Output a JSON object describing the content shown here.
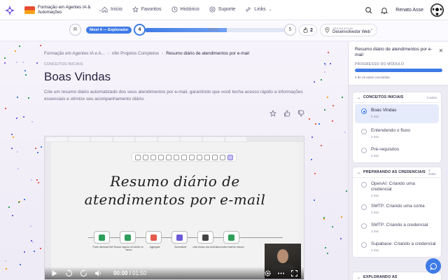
{
  "topnav": {
    "course_title": "Formação em Agentes IA & Automações",
    "links": [
      {
        "label": "Início",
        "icon": "home-icon"
      },
      {
        "label": "Favoritos",
        "icon": "star-icon"
      },
      {
        "label": "Histórico",
        "icon": "clock-icon"
      },
      {
        "label": "Suporte",
        "icon": "help-icon"
      },
      {
        "label": "Links",
        "icon": "link-icon"
      }
    ],
    "user_name": "Renato Asse"
  },
  "progress": {
    "rank": "R",
    "level_label": "Nível 4 — Explorador",
    "level_current": "4",
    "level_next": "5",
    "xp_text": "88/150",
    "xp_fraction": 0.587,
    "streak": "2",
    "track_small": "TRILHA ATUAL",
    "track_name": "Desenvolvedor Web"
  },
  "main": {
    "crumbs": [
      "Formação em Agentes IA e A...",
      "n8n Projetos Completos",
      "Resumo diário de atendimentos por e-mail"
    ],
    "section_tag": "CONCEITOS INICIAIS",
    "title": "Boas Vindas",
    "description": "Crie um resumo diário automatizado dos seus atendimentos por e-mail, garantindo que você tenha acesso rápido a informações essenciais e otimize seu acompanhamento diário."
  },
  "video": {
    "caption_line1": "Resumo diário de",
    "caption_line2": "atendimentos por e-mail",
    "nodes": [
      {
        "label": "Poder demanda Sail",
        "color": "#2e9e5b"
      },
      {
        "label": "Buscar negócio do Interior no banco",
        "color": "#2e9e5b"
      },
      {
        "label": "Aggregate",
        "color": "#e25b4b"
      },
      {
        "label": "Summarizer",
        "color": "#6a5ad8"
      },
      {
        "label": "criar resumo dos conteúdos",
        "color": "#444444"
      },
      {
        "label": "enviar email de resumo",
        "color": "#2e9e5b"
      }
    ],
    "time_current": "00:00",
    "time_total": "01:50"
  },
  "sidebar": {
    "title": "Resumo diário de atendimentos por e-mail",
    "progress_label": "PROGRESSO DO MÓDULO",
    "progress_fraction": 1.0,
    "count_text": "0 de 15 aulas concluídas",
    "modules": [
      {
        "name": "CONCEITOS INICIAIS",
        "count": "3 aulas",
        "lessons": [
          {
            "name": "Boas Vindas",
            "dur": "2 min",
            "active": true
          },
          {
            "name": "Entendendo o fluxo",
            "dur": "2 min"
          },
          {
            "name": "Pré-requisitos",
            "dur": "2 min"
          }
        ]
      },
      {
        "name": "PREPARANDO AS CREDENCIAIS",
        "count": "4 aulas",
        "lessons": [
          {
            "name": "OpenAI: Criando uma credencial",
            "dur": "2 min"
          },
          {
            "name": "SMTP: Criando uma conta",
            "dur": "2 min"
          },
          {
            "name": "SMTP: Criando a credencial",
            "dur": "2 min"
          },
          {
            "name": "Supabase: Criando a credencial",
            "dur": "2 min"
          }
        ]
      },
      {
        "name": "EXPLORANDO AS",
        "count": ""
      }
    ]
  }
}
